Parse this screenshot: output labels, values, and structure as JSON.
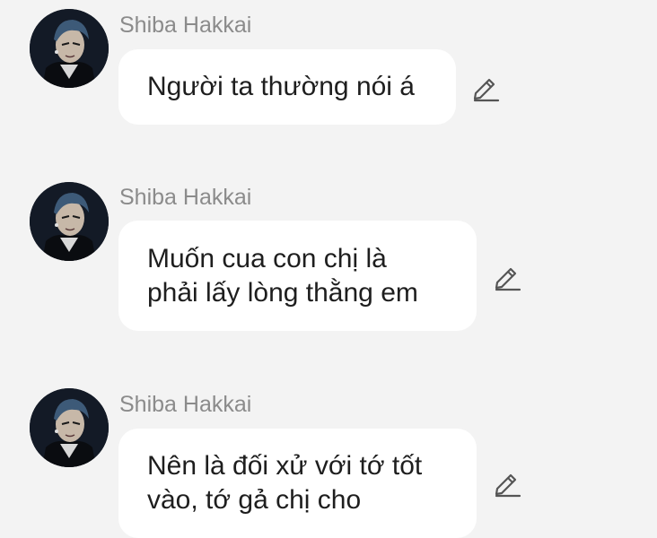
{
  "messages": [
    {
      "sender": "Shiba Hakkai",
      "lines": [
        "Người ta thường nói á"
      ],
      "avatar_icon": "user-avatar-icon",
      "action_icon": "edit-pencil-icon"
    },
    {
      "sender": "Shiba Hakkai",
      "lines": [
        "Muốn cua con chị là",
        "phải lấy lòng thằng em"
      ],
      "avatar_icon": "user-avatar-icon",
      "action_icon": "edit-pencil-icon"
    },
    {
      "sender": "Shiba Hakkai",
      "lines": [
        "Nên là đối xử với tớ tốt",
        "vào, tớ gả chị cho"
      ],
      "avatar_icon": "user-avatar-icon",
      "action_icon": "edit-pencil-icon"
    }
  ],
  "colors": {
    "background": "#f3f3f3",
    "bubble": "#ffffff",
    "sender_text": "#8b8b8b",
    "message_text": "#1e1e1e",
    "icon": "#555555"
  }
}
